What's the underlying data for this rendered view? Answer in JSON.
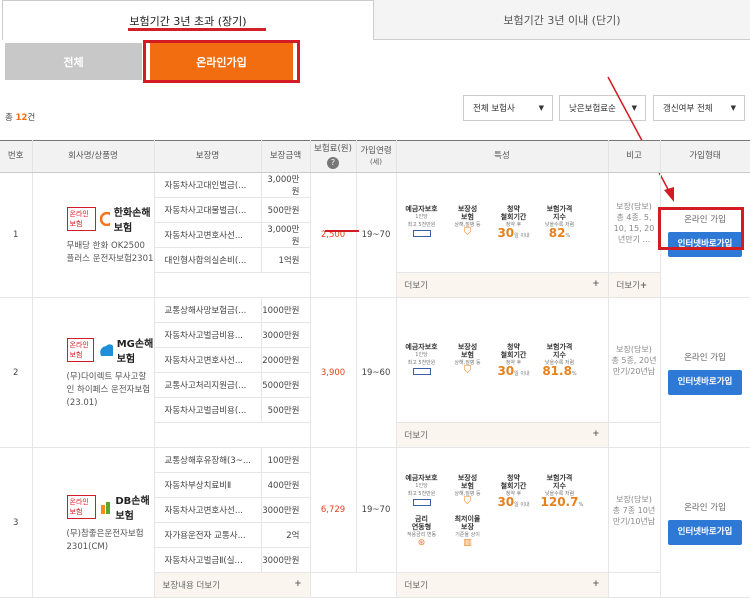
{
  "period_tabs": [
    "보험기간 3년 초과 (장기)",
    "보험기간 3년 이내 (단기)"
  ],
  "sub_tabs": [
    "전체",
    "온라인가입"
  ],
  "total": {
    "prefix": "총 ",
    "count": "12",
    "suffix": "건"
  },
  "filters": [
    "전체 보험사",
    "낮은보험료순",
    "갱신여부 전체"
  ],
  "caret": "▼",
  "headers": {
    "no": "번호",
    "company": "회사명/상품명",
    "coverage": "보장명",
    "amount": "보장금액",
    "premium": "보험료(원)",
    "age": "가입연령",
    "age_unit": "(세)",
    "features": "특성",
    "note": "비고",
    "apply": "가입형태"
  },
  "help_icon": "?",
  "more_label": "더보기",
  "cov_more_label": "보장내용 더보기",
  "plus": "+",
  "feature_labels": {
    "deposit": "예금자보호",
    "deposit_sub": "1인당",
    "deposit_sub2": "최고 5천만원",
    "reg": "보장성",
    "reg2": "보험",
    "reg_sub": "상해,질병 등",
    "cancel": "청약",
    "cancel2": "철회기간",
    "cancel_sub": "청약 후",
    "cancel_val": "30",
    "cancel_unit": "일 이내",
    "price": "보험가격",
    "price2": "지수",
    "price_sub": "낮을수록 저렴",
    "rate": "금리",
    "rate2": "연동형",
    "rate_sub": "적용금리 변동",
    "min": "최저이율",
    "min2": "보장",
    "min_sub": "기준율 상이"
  },
  "rows": [
    {
      "no": "1",
      "tag": "온라인보험",
      "brand": "한화손해보험",
      "product": "무배당 한화 OK2500 플러스 운전자보험2301",
      "coverages": [
        [
          "자동차사고대인벌금(...",
          "3,000만원"
        ],
        [
          "자동차사고대물벌금(...",
          "500만원"
        ],
        [
          "자동차사고변호사선...",
          "3,000만원"
        ],
        [
          "대인형사합의실손비(...",
          "1억원"
        ]
      ],
      "premium": "2,500",
      "age": "19~70",
      "price_val": "82",
      "price_unit": "%",
      "note": "보장(담보) 총 4종. 5, 10, 15, 20년만기 ...",
      "apply": "온라인 가입",
      "btn": "인터넷바로가입",
      "more_note": "더보기"
    },
    {
      "no": "2",
      "tag": "온라인보험",
      "brand": "MG손해보험",
      "product": "(무)다이렉트 무사고할인 하이페스 운전자보험(23.01)",
      "coverages": [
        [
          "교통상해사망보험금(...",
          "1000만원"
        ],
        [
          "자동차사고벌금비용...",
          "3000만원"
        ],
        [
          "자동차사고변호사선...",
          "2000만원"
        ],
        [
          "교통사고처리지원금(...",
          "5000만원"
        ],
        [
          "자동차사고벌금비용(...",
          "500만원"
        ]
      ],
      "premium": "3,900",
      "age": "19~60",
      "price_val": "81.8",
      "price_unit": "%",
      "note": "보장(담보) 총 5종, 20년만기/20년납",
      "apply": "온라인 가입",
      "btn": "인터넷바로가입"
    },
    {
      "no": "3",
      "tag": "온라인보험",
      "brand": "DB손해보험",
      "product": "(무)참좋은운전자보험2301(CM)",
      "coverages": [
        [
          "교통상해후유장해(3~...",
          "100만원"
        ],
        [
          "자동차부상치료비Ⅱ",
          "400만원"
        ],
        [
          "자동차사고변호사선...",
          "3000만원"
        ],
        [
          "자가용운전자 교통사...",
          "2억"
        ],
        [
          "자동차사고벌금Ⅱ(실...",
          "3000만원"
        ]
      ],
      "premium": "6,729",
      "age": "19~70",
      "price_val": "120.7",
      "price_unit": "%",
      "note": "보장(담보) 총 7종 10년만기/10년납",
      "apply": "온라인 가입",
      "btn": "인터넷바로가입"
    }
  ]
}
